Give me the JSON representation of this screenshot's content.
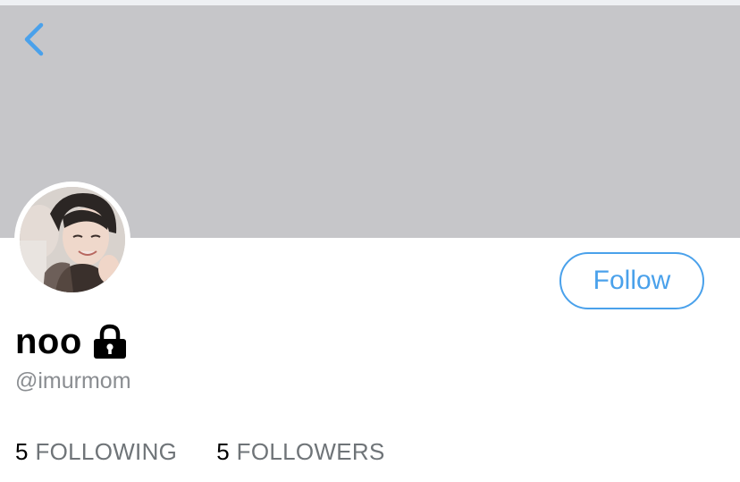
{
  "profile": {
    "display_name": "noo",
    "handle": "@imurmom",
    "follow_label": "Follow",
    "following_count": "5",
    "following_label": "FOLLOWING",
    "followers_count": "5",
    "followers_label": "FOLLOWERS",
    "locked": true
  },
  "icons": {
    "back": "chevron-left-icon",
    "lock": "lock-icon"
  },
  "colors": {
    "accent": "#4aa1eb",
    "banner": "#c6c6c9",
    "secondary_text": "#8a8d91"
  }
}
